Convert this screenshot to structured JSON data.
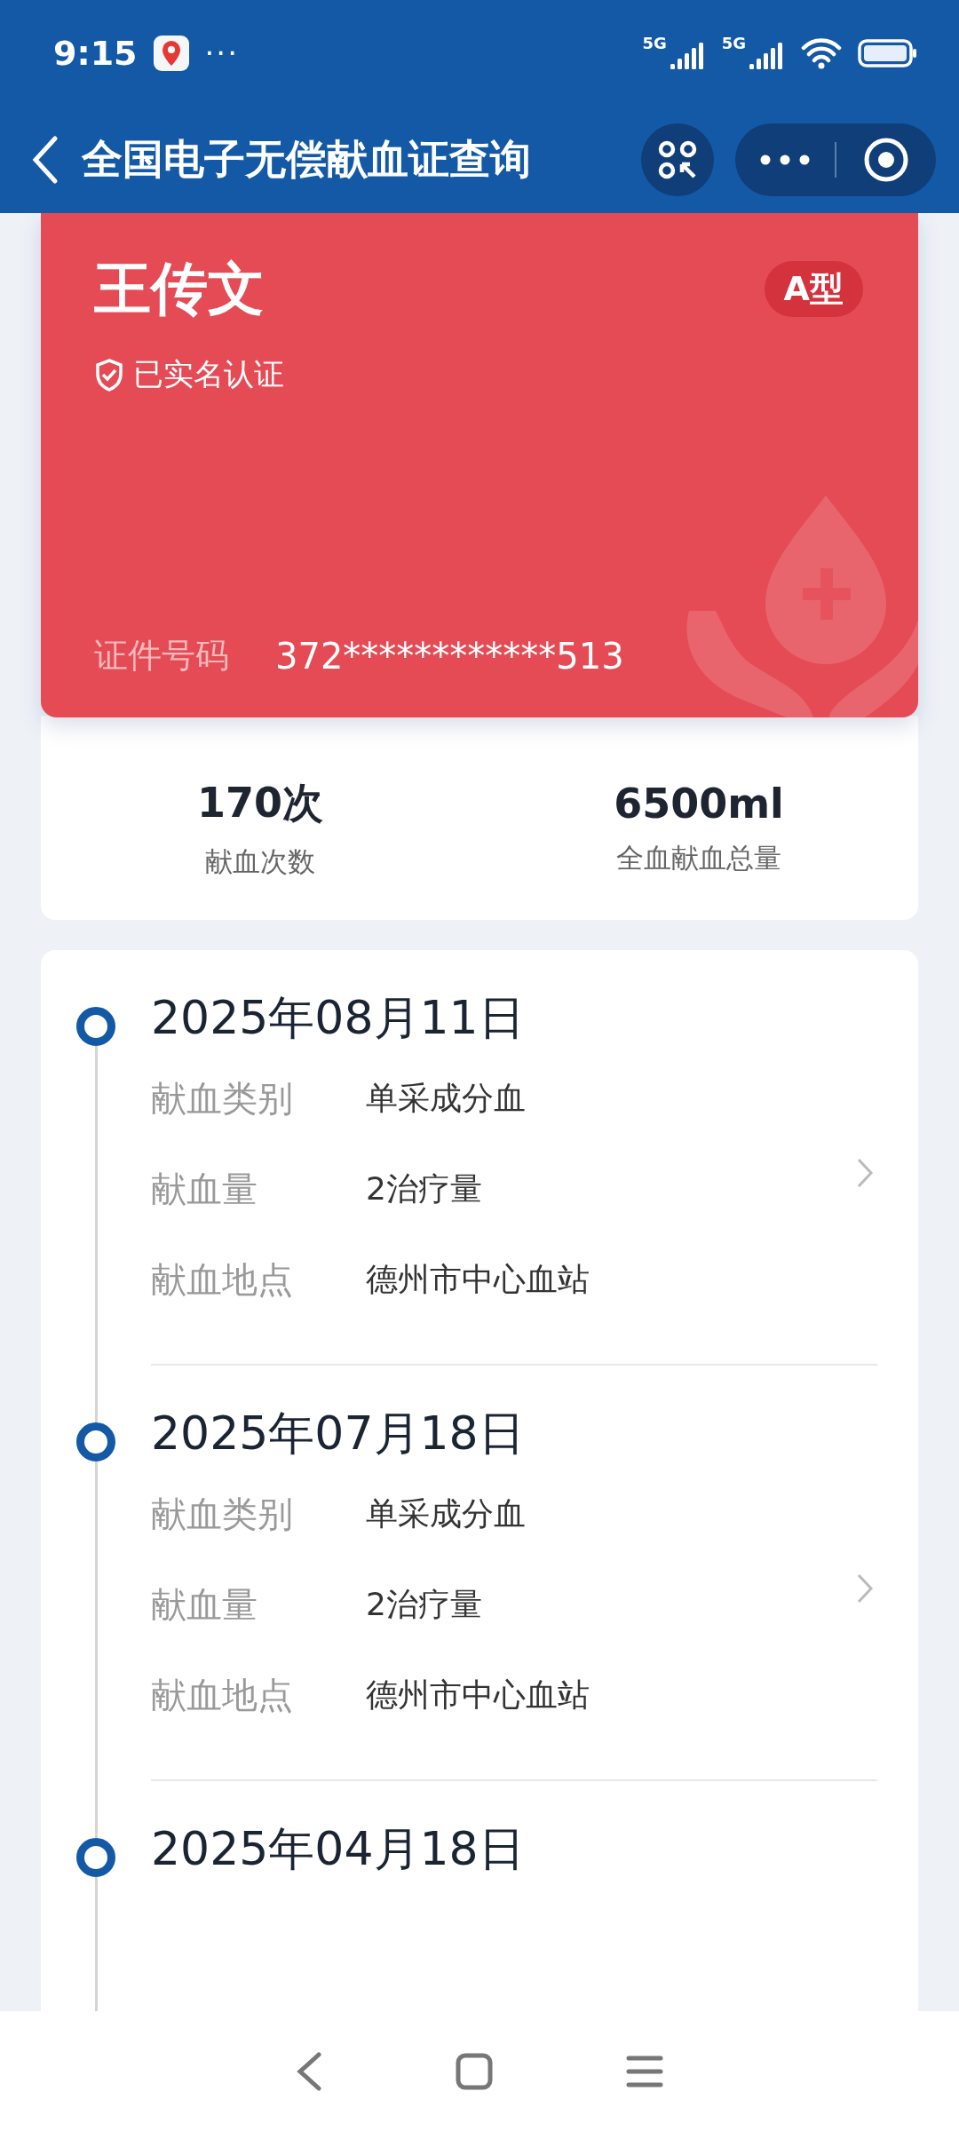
{
  "status_bar": {
    "time": "9:15",
    "notification_dots": "···",
    "network_labels": [
      "5G",
      "5G"
    ]
  },
  "header": {
    "title": "全国电子无偿献血证查询"
  },
  "card": {
    "name": "王传文",
    "blood_type": "A型",
    "verified_label": "已实名认证",
    "id_label": "证件号码",
    "id_value": "372************513"
  },
  "stats": [
    {
      "value": "170次",
      "label": "献血次数"
    },
    {
      "value": "6500ml",
      "label": "全血献血总量"
    }
  ],
  "records": [
    {
      "date": "2025年08月11日",
      "fields": [
        {
          "label": "献血类别",
          "value": "单采成分血"
        },
        {
          "label": "献血量",
          "value": "2治疗量"
        },
        {
          "label": "献血地点",
          "value": "德州市中心血站"
        }
      ]
    },
    {
      "date": "2025年07月18日",
      "fields": [
        {
          "label": "献血类别",
          "value": "单采成分血"
        },
        {
          "label": "献血量",
          "value": "2治疗量"
        },
        {
          "label": "献血地点",
          "value": "德州市中心血站"
        }
      ]
    },
    {
      "date": "2025年04月18日"
    }
  ]
}
